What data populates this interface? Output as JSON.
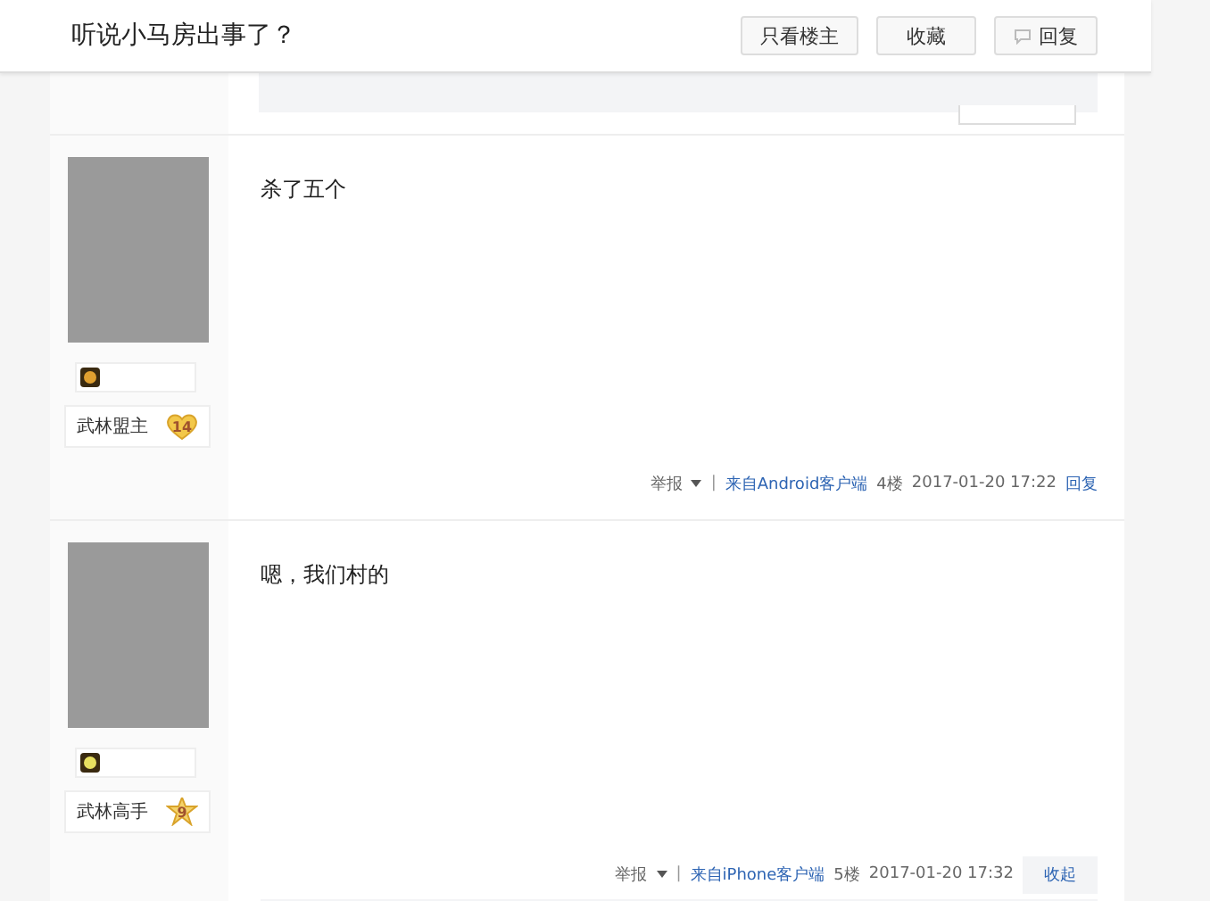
{
  "header": {
    "title": "听说小马房出事了？",
    "buttons": [
      {
        "label": "只看楼主",
        "kind": "plain"
      },
      {
        "label": "收藏",
        "kind": "plain"
      },
      {
        "label": "回复",
        "kind": "reply"
      }
    ]
  },
  "posts": [
    {
      "content": "杀了五个",
      "user": {
        "name": "武林盟主",
        "badge": {
          "kind": "heart",
          "level": "14"
        }
      },
      "footer": {
        "report": "举报",
        "separator": "|",
        "source": "来自Android客户端",
        "floor": "4楼",
        "time": "2017-01-20 17:22",
        "action": "回复"
      },
      "replies_open": false
    },
    {
      "content": "嗯，我们村的",
      "user": {
        "name": "武林高手",
        "badge": {
          "kind": "star",
          "level": "9"
        }
      },
      "footer": {
        "report": "举报",
        "separator": "|",
        "source": "来自iPhone客户端",
        "floor": "5楼",
        "time": "2017-01-20 17:32",
        "action": "收起"
      },
      "replies_open": true
    }
  ]
}
